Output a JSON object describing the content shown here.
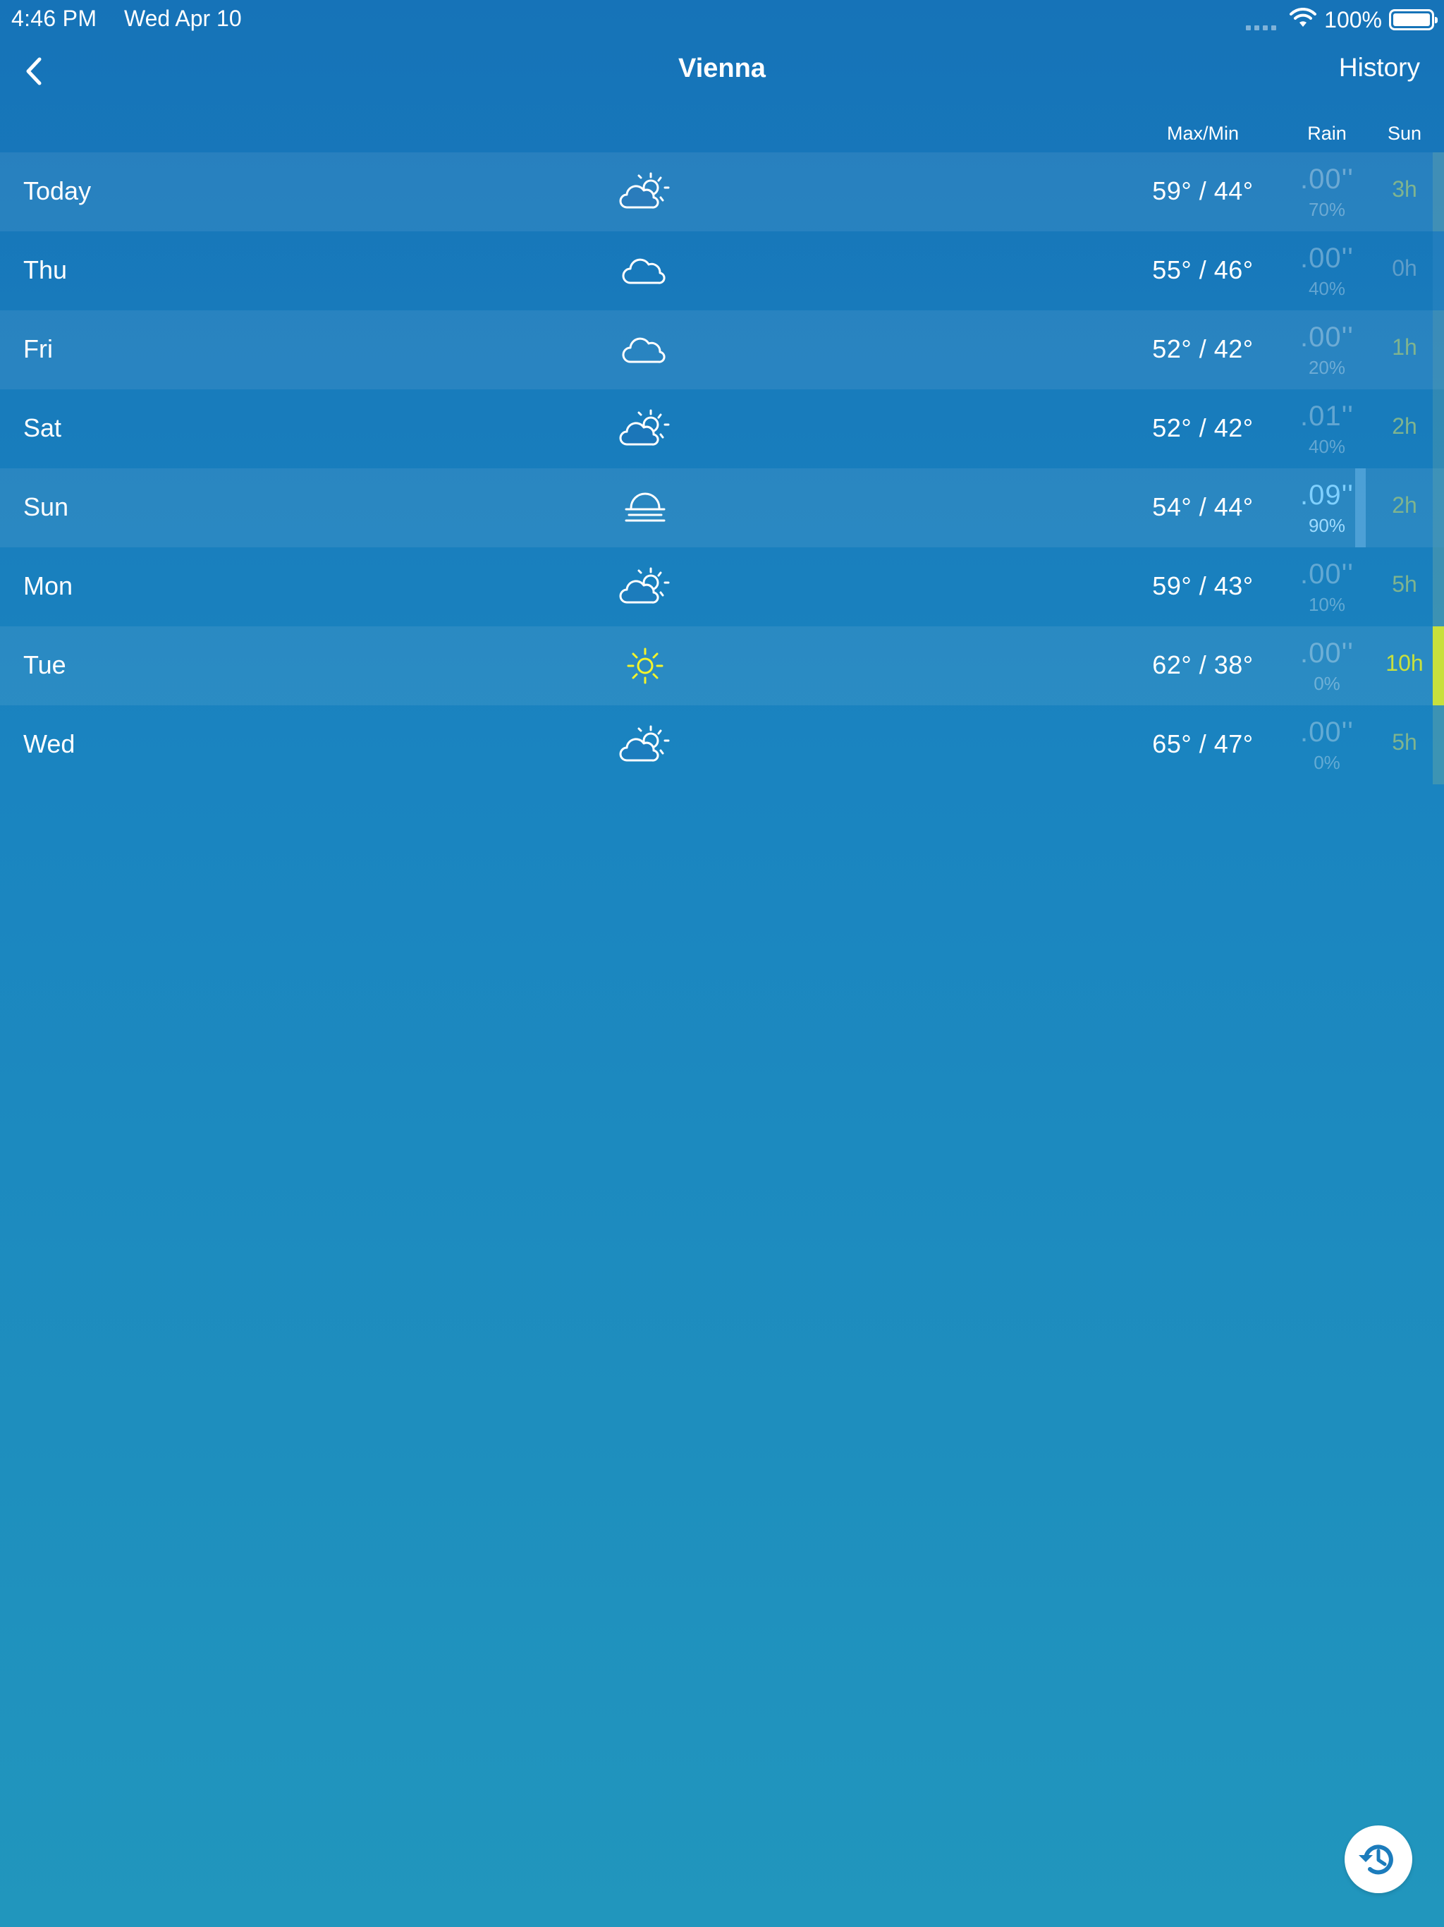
{
  "status_bar": {
    "time": "4:46 PM",
    "date": "Wed Apr 10",
    "battery": "100%"
  },
  "nav": {
    "title": "Vienna",
    "history_label": "History"
  },
  "columns": {
    "maxmin": "Max/Min",
    "rain": "Rain",
    "sun": "Sun"
  },
  "colors": {
    "rain_highlight": "#7fd0ff",
    "sun_strong": "#c8e03c",
    "sun_muted": "#7fb48f",
    "sun_none": "#5f9ec9",
    "sun_icon": "#f4f42a"
  },
  "days": [
    {
      "name": "Today",
      "icon": "partly-cloudy-icon",
      "temps": "59° / 44°",
      "rain": ".00''",
      "chance": "70%",
      "sun": "3h",
      "sun_level": 0.3
    },
    {
      "name": "Thu",
      "icon": "cloud-icon",
      "temps": "55° / 46°",
      "rain": ".00''",
      "chance": "40%",
      "sun": "0h",
      "sun_level": 0.0
    },
    {
      "name": "Fri",
      "icon": "cloud-icon",
      "temps": "52° / 42°",
      "rain": ".00''",
      "chance": "20%",
      "sun": "1h",
      "sun_level": 0.1
    },
    {
      "name": "Sat",
      "icon": "partly-cloudy-icon",
      "temps": "52° / 42°",
      "rain": ".01''",
      "chance": "40%",
      "sun": "2h",
      "sun_level": 0.2
    },
    {
      "name": "Sun",
      "icon": "fog-icon",
      "temps": "54° / 44°",
      "rain": ".09''",
      "chance": "90%",
      "sun": "2h",
      "sun_level": 0.2
    },
    {
      "name": "Mon",
      "icon": "partly-cloudy-icon",
      "temps": "59° / 43°",
      "rain": ".00''",
      "chance": "10%",
      "sun": "5h",
      "sun_level": 0.5
    },
    {
      "name": "Tue",
      "icon": "sun-icon",
      "temps": "62° / 38°",
      "rain": ".00''",
      "chance": "0%",
      "sun": "10h",
      "sun_level": 1.0
    },
    {
      "name": "Wed",
      "icon": "partly-cloudy-icon",
      "temps": "65° / 47°",
      "rain": ".00''",
      "chance": "0%",
      "sun": "5h",
      "sun_level": 0.5
    }
  ]
}
